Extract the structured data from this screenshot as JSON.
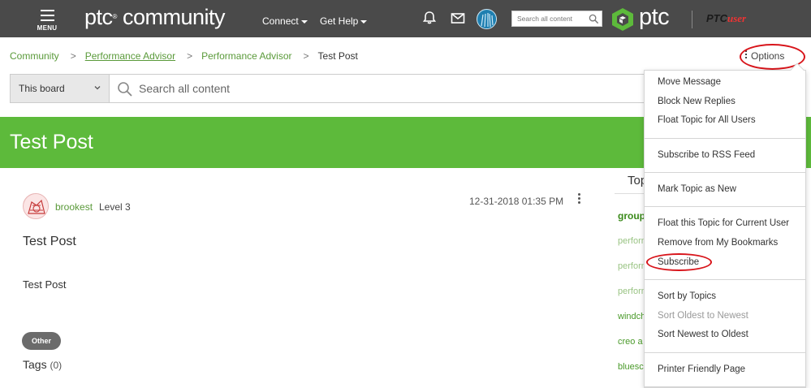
{
  "topnav": {
    "menu_label": "MENU",
    "logo_text": "ptc",
    "logo_suffix": "community",
    "links": [
      "Connect",
      "Get Help"
    ],
    "search_placeholder": "Search all content",
    "brand": "ptc",
    "partner_prefix": "PTC",
    "partner_suffix": "user"
  },
  "breadcrumb": {
    "items": [
      "Community",
      "Performance Advisor",
      "Performance Advisor"
    ],
    "current": "Test Post",
    "separator": ">"
  },
  "options": {
    "label": "Options"
  },
  "search": {
    "scope": "This board",
    "placeholder": "Search all content"
  },
  "title": "Test Post",
  "post": {
    "author": "brookest",
    "level": "Level 3",
    "date": "12-31-2018 01:35 PM",
    "subject": "Test Post",
    "body": "Test Post",
    "tag": "Other",
    "tags_label": "Tags",
    "tags_count": "(0)"
  },
  "sidebar": {
    "header": "Topi",
    "links": [
      "group",
      "perform",
      "perform",
      "perform",
      "windch",
      "creo a",
      "bluesc"
    ]
  },
  "menu": {
    "group1": [
      "Move Message",
      "Block New Replies",
      "Float Topic for All Users"
    ],
    "group2": [
      "Subscribe to RSS Feed"
    ],
    "group3": [
      "Mark Topic as New"
    ],
    "group4": [
      "Float this Topic for Current User",
      "Remove from My Bookmarks",
      "Subscribe"
    ],
    "group5": [
      "Sort by Topics",
      "Sort Oldest to Newest",
      "Sort Newest to Oldest"
    ],
    "group6": [
      "Printer Friendly Page"
    ]
  },
  "colors": {
    "nav_bg": "#4a4a4a",
    "accent_green": "#5dba3b",
    "link_green": "#5a9a3a",
    "annotation_red": "#d8141a"
  },
  "icons": [
    "bell-icon",
    "mail-icon",
    "search-icon",
    "chevron-down-icon",
    "more-vertical-icon",
    "ptc-logo-icon"
  ]
}
